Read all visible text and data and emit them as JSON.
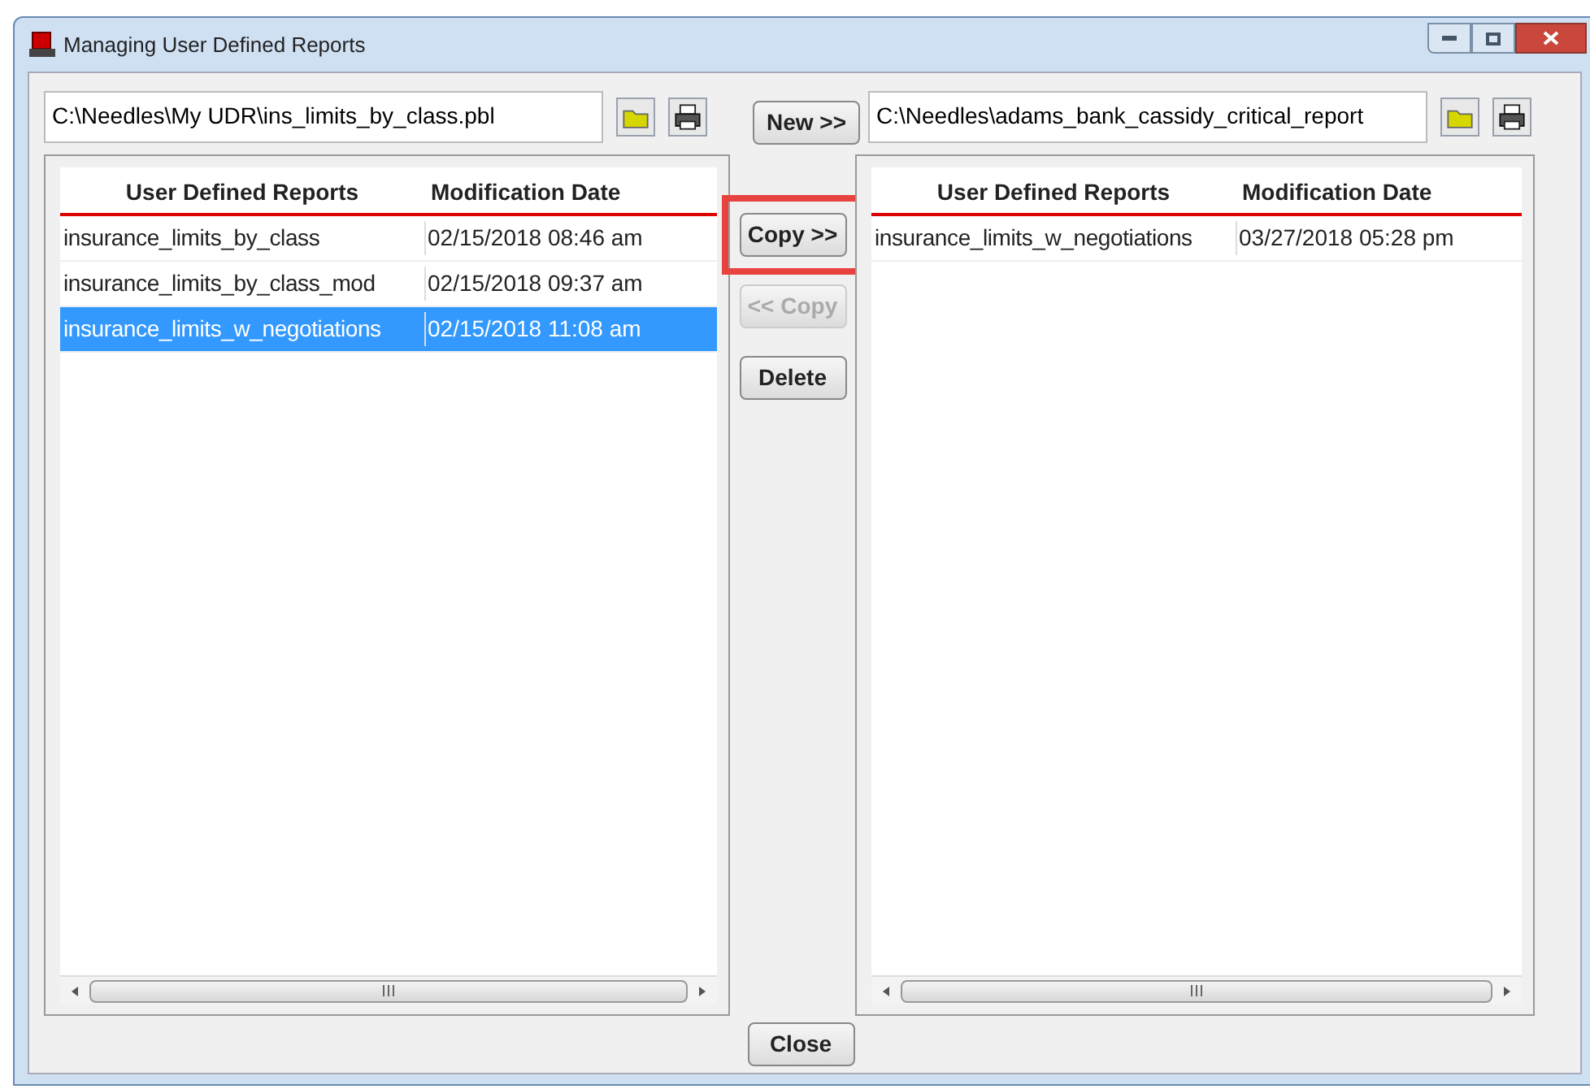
{
  "window": {
    "title": "Managing User Defined Reports"
  },
  "left": {
    "path": "C:\\Needles\\My UDR\\ins_limits_by_class.pbl",
    "columns": [
      "User Defined Reports",
      "Modification Date"
    ],
    "rows": [
      {
        "cells": [
          "insurance_limits_by_class",
          "02/15/2018 08:46 am"
        ],
        "selected": false
      },
      {
        "cells": [
          "insurance_limits_by_class_mod",
          "02/15/2018 09:37 am"
        ],
        "selected": false
      },
      {
        "cells": [
          "insurance_limits_w_negotiations",
          "02/15/2018 11:08 am"
        ],
        "selected": true
      }
    ]
  },
  "new_button": "New >>",
  "middle_buttons": [
    {
      "label": "Copy >>",
      "disabled": false,
      "highlighted": true
    },
    {
      "label": "<< Copy",
      "disabled": true,
      "highlighted": false
    },
    {
      "label": "Delete",
      "disabled": false,
      "highlighted": false
    }
  ],
  "right": {
    "path": "C:\\Needles\\adams_bank_cassidy_critical_report",
    "columns": [
      "User Defined Reports",
      "Modification Date"
    ],
    "rows": [
      {
        "cells": [
          "insurance_limits_w_negotiations",
          "03/27/2018 05:28 pm"
        ],
        "selected": false
      }
    ]
  },
  "close_button": "Close"
}
